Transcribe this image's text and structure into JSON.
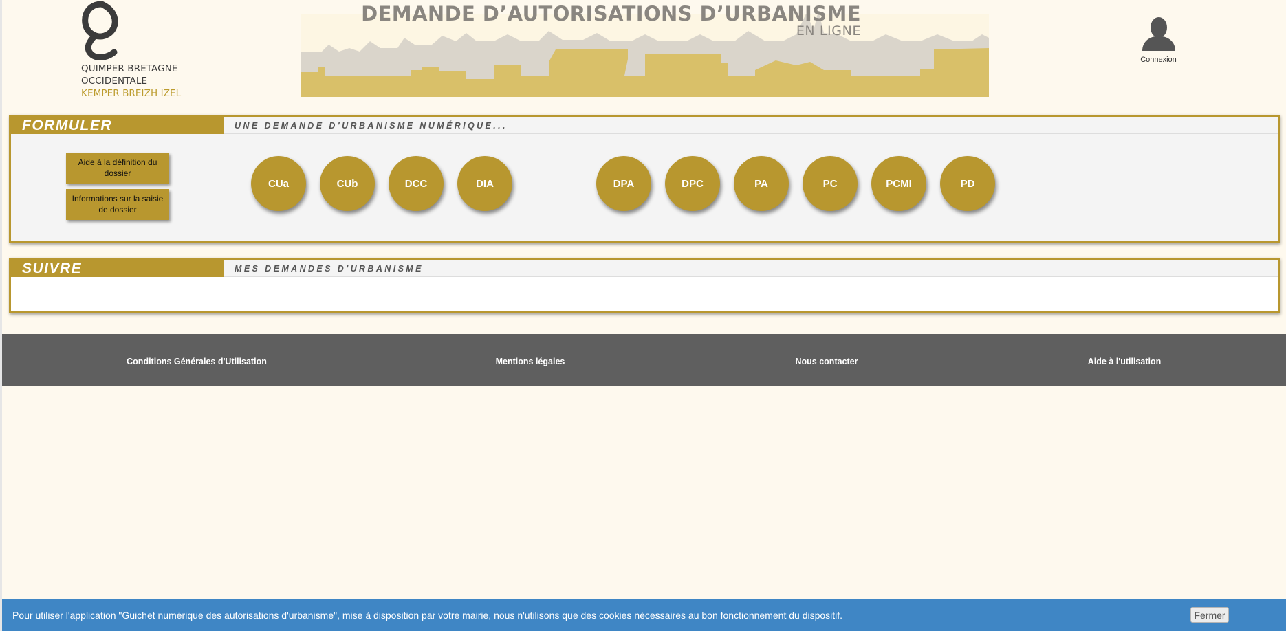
{
  "header": {
    "logo": {
      "line1": "QUIMPER BRETAGNE",
      "line2": "OCCIDENTALE",
      "line3": "KEMPER BREIZH IZEL"
    },
    "banner_title": "DEMANDE D’AUTORISATIONS D’URBANISME",
    "banner_subtitle": "EN LIGNE",
    "login_label": "Connexion",
    "login_icon": "user-icon"
  },
  "formuler": {
    "title": "FORMULER",
    "subtitle": "UNE DEMANDE D'URBANISME NUMÉRIQUE...",
    "help_buttons": [
      "Aide à la définition du dossier",
      "Informations sur la saisie de dossier"
    ],
    "dossier_types": [
      "CUa",
      "CUb",
      "DCC",
      "DIA",
      "DPA",
      "DPC",
      "PA",
      "PC",
      "PCMI",
      "PD"
    ]
  },
  "suivre": {
    "title": "SUIVRE",
    "subtitle": "MES DEMANDES D'URBANISME"
  },
  "footer": {
    "links": [
      "Conditions Générales d'Utilisation",
      "Mentions légales",
      "Nous contacter",
      "Aide à l'utilisation"
    ]
  },
  "cookie_bar": {
    "message": "Pour utiliser l'application \"Guichet numérique des autorisations d'urbanisme\", mise à disposition par votre mairie, nous n'utilisons que des cookies nécessaires au bon fonctionnement du dispositif.",
    "close_label": "Fermer"
  },
  "colors": {
    "background": "#fef9ee",
    "gold": "#b8972f",
    "footer": "#5f5f5f",
    "cookie_bar": "#3f86c5"
  }
}
